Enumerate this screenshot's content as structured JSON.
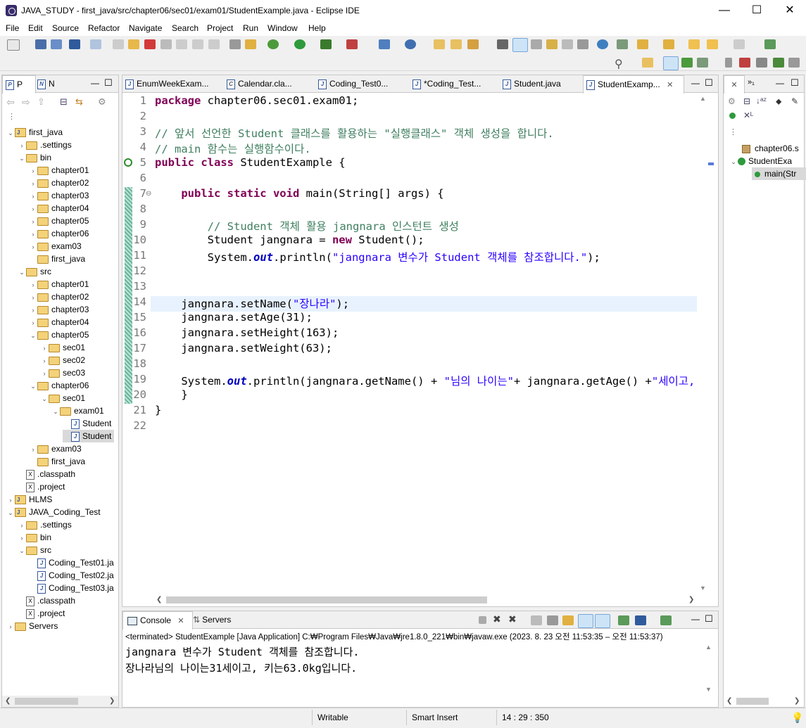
{
  "window": {
    "title": "JAVA_STUDY - first_java/src/chapter06/sec01/exam01/StudentExample.java - Eclipse IDE",
    "minimize_glyph": "—",
    "maximize_glyph": "☐",
    "close_glyph": "✕"
  },
  "menu": [
    "File",
    "Edit",
    "Source",
    "Refactor",
    "Navigate",
    "Search",
    "Project",
    "Run",
    "Window",
    "Help"
  ],
  "left_panel": {
    "tabs": [
      "P",
      "N"
    ],
    "tree": [
      {
        "label": "first_java",
        "indent": 0,
        "twisty": "open",
        "icon": "project"
      },
      {
        "label": ".settings",
        "indent": 1,
        "twisty": "closed",
        "icon": "folder"
      },
      {
        "label": "bin",
        "indent": 1,
        "twisty": "open",
        "icon": "folder"
      },
      {
        "label": "chapter01",
        "indent": 2,
        "twisty": "closed",
        "icon": "folder"
      },
      {
        "label": "chapter02",
        "indent": 2,
        "twisty": "closed",
        "icon": "folder"
      },
      {
        "label": "chapter03",
        "indent": 2,
        "twisty": "closed",
        "icon": "folder"
      },
      {
        "label": "chapter04",
        "indent": 2,
        "twisty": "closed",
        "icon": "folder"
      },
      {
        "label": "chapter05",
        "indent": 2,
        "twisty": "closed",
        "icon": "folder"
      },
      {
        "label": "chapter06",
        "indent": 2,
        "twisty": "closed",
        "icon": "folder"
      },
      {
        "label": "exam03",
        "indent": 2,
        "twisty": "closed",
        "icon": "folder"
      },
      {
        "label": "first_java",
        "indent": 2,
        "twisty": "none",
        "icon": "folder"
      },
      {
        "label": "src",
        "indent": 1,
        "twisty": "open",
        "icon": "folder"
      },
      {
        "label": "chapter01",
        "indent": 2,
        "twisty": "closed",
        "icon": "folder"
      },
      {
        "label": "chapter02",
        "indent": 2,
        "twisty": "closed",
        "icon": "folder"
      },
      {
        "label": "chapter03",
        "indent": 2,
        "twisty": "closed",
        "icon": "folder"
      },
      {
        "label": "chapter04",
        "indent": 2,
        "twisty": "closed",
        "icon": "folder"
      },
      {
        "label": "chapter05",
        "indent": 2,
        "twisty": "open",
        "icon": "folder"
      },
      {
        "label": "sec01",
        "indent": 3,
        "twisty": "closed",
        "icon": "folder"
      },
      {
        "label": "sec02",
        "indent": 3,
        "twisty": "closed",
        "icon": "folder"
      },
      {
        "label": "sec03",
        "indent": 3,
        "twisty": "closed",
        "icon": "folder"
      },
      {
        "label": "chapter06",
        "indent": 2,
        "twisty": "open",
        "icon": "folder"
      },
      {
        "label": "sec01",
        "indent": 3,
        "twisty": "open",
        "icon": "folder"
      },
      {
        "label": "exam01",
        "indent": 4,
        "twisty": "open",
        "icon": "folder"
      },
      {
        "label": "Student",
        "indent": 5,
        "twisty": "none",
        "icon": "java"
      },
      {
        "label": "Student",
        "indent": 5,
        "twisty": "none",
        "icon": "java",
        "selected": true
      },
      {
        "label": "exam03",
        "indent": 2,
        "twisty": "closed",
        "icon": "folder"
      },
      {
        "label": "first_java",
        "indent": 2,
        "twisty": "none",
        "icon": "folder"
      },
      {
        "label": ".classpath",
        "indent": 1,
        "twisty": "none",
        "icon": "xml"
      },
      {
        "label": ".project",
        "indent": 1,
        "twisty": "none",
        "icon": "xml"
      },
      {
        "label": "HLMS",
        "indent": 0,
        "twisty": "closed",
        "icon": "project"
      },
      {
        "label": "JAVA_Coding_Test",
        "indent": 0,
        "twisty": "open",
        "icon": "project"
      },
      {
        "label": ".settings",
        "indent": 1,
        "twisty": "closed",
        "icon": "folder"
      },
      {
        "label": "bin",
        "indent": 1,
        "twisty": "closed",
        "icon": "folder"
      },
      {
        "label": "src",
        "indent": 1,
        "twisty": "open",
        "icon": "folder"
      },
      {
        "label": "Coding_Test01.ja",
        "indent": 2,
        "twisty": "none",
        "icon": "java"
      },
      {
        "label": "Coding_Test02.ja",
        "indent": 2,
        "twisty": "none",
        "icon": "java"
      },
      {
        "label": "Coding_Test03.ja",
        "indent": 2,
        "twisty": "none",
        "icon": "java"
      },
      {
        "label": ".classpath",
        "indent": 1,
        "twisty": "none",
        "icon": "xml"
      },
      {
        "label": ".project",
        "indent": 1,
        "twisty": "none",
        "icon": "xml"
      },
      {
        "label": "Servers",
        "indent": 0,
        "twisty": "closed",
        "icon": "folder"
      }
    ]
  },
  "editor": {
    "tabs": [
      {
        "label": "EnumWeekExam...",
        "active": false
      },
      {
        "label": "Calendar.cla...",
        "active": false
      },
      {
        "label": "Coding_Test0...",
        "active": false
      },
      {
        "label": "*Coding_Test...",
        "active": false
      },
      {
        "label": "Student.java",
        "active": false
      },
      {
        "label": "StudentExamp...",
        "active": true
      }
    ],
    "tab_close_glyph": "✕",
    "line_numbers": [
      "1",
      "2",
      "3",
      "4",
      "5",
      "6",
      "7",
      "8",
      "9",
      "10",
      "11",
      "12",
      "13",
      "14",
      "15",
      "16",
      "17",
      "18",
      "19",
      "20",
      "21",
      "22"
    ],
    "cursor_line": 14
  },
  "outline": {
    "items": [
      {
        "label": "chapter06.s"
      },
      {
        "label": "StudentExa"
      },
      {
        "label": "main(Str"
      }
    ]
  },
  "console": {
    "tabs": [
      {
        "label": "Console"
      },
      {
        "label": "Servers"
      }
    ],
    "header": "<terminated> StudentExample [Java Application] C:₩Program Files₩Java₩jre1.8.0_221₩bin₩javaw.exe  (2023. 8. 23 오전 11:53:35 – 오전 11:53:37)",
    "lines": [
      "jangnara 변수가 Student 객체를 참조합니다.",
      "장나라님의 나이는31세이고, 키는63.0kg입니다."
    ]
  },
  "statusbar": {
    "writable": "Writable",
    "insert_mode": "Smart Insert",
    "position": "14 : 29 : 350"
  }
}
